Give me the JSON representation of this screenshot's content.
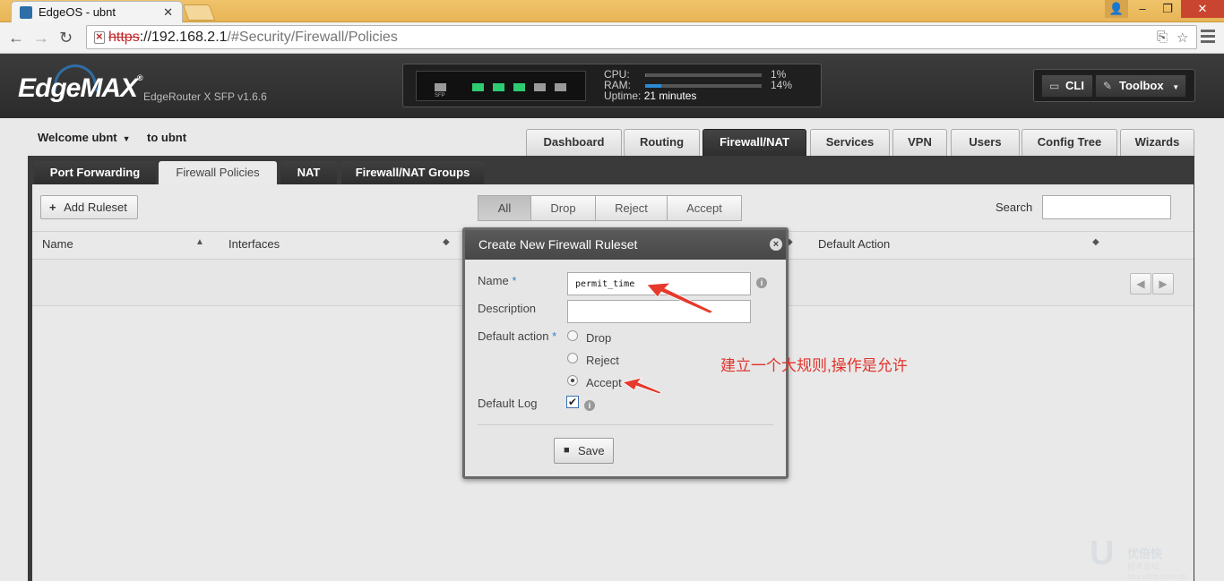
{
  "browser": {
    "tab_title": "EdgeOS - ubnt",
    "tab_close": "✕",
    "url_scheme": "https",
    "url_host": "://192.168.2.1",
    "url_path": "/#Security/Firewall/Policies",
    "window_buttons": {
      "user": "👤",
      "minimize": "–",
      "maximize": "❐",
      "close": "✕"
    }
  },
  "header": {
    "logo": "EdgeMAX",
    "logo_mark": "®",
    "model": "EdgeRouter X SFP v1.6.6",
    "sfp_label": "SFP",
    "ports": [
      false,
      true,
      true,
      true,
      false,
      false
    ],
    "stats": {
      "cpu_label": "CPU:",
      "cpu_value": "1%",
      "cpu_fraction": 0.01,
      "ram_label": "RAM:",
      "ram_value": "14%",
      "ram_fraction": 0.14,
      "uptime_label": "Uptime:",
      "uptime_value": "21 minutes"
    },
    "cli_label": "CLI",
    "toolbox_label": "Toolbox"
  },
  "user": {
    "welcome": "Welcome ubnt",
    "to_label": "to ubnt"
  },
  "main_tabs": [
    "Dashboard",
    "Routing",
    "Firewall/NAT",
    "Services",
    "VPN",
    "Users",
    "Config Tree",
    "Wizards"
  ],
  "active_main_tab": "Firewall/NAT",
  "sub_tabs": [
    "Port Forwarding",
    "Firewall Policies",
    "NAT",
    "Firewall/NAT Groups"
  ],
  "active_sub_tab": "Firewall Policies",
  "toolbar": {
    "add_ruleset": "Add Ruleset",
    "filters": [
      "All",
      "Drop",
      "Reject",
      "Accept"
    ],
    "active_filter": "All",
    "search_label": "Search",
    "search_value": ""
  },
  "table": {
    "columns": [
      "Name",
      "Interfaces",
      "Default Action"
    ]
  },
  "modal": {
    "title": "Create New Firewall Ruleset",
    "name_label": "Name",
    "name_value": "permit_time",
    "description_label": "Description",
    "description_value": "",
    "default_action_label": "Default action",
    "actions": [
      "Drop",
      "Reject",
      "Accept"
    ],
    "selected_action": "Accept",
    "default_log_label": "Default Log",
    "default_log_checked": true,
    "save_label": "Save",
    "required_mark": "*"
  },
  "annotation": {
    "text": "建立一个大规则,操作是允许",
    "color": "#e0342c"
  },
  "watermark": {
    "text": "优倍快",
    "sub": "技术论坛 bbs.ubnt.com.cn"
  },
  "colors": {
    "accent": "#2a8ad4",
    "port_on": "#2ecc71",
    "annotation": "#e0342c"
  }
}
